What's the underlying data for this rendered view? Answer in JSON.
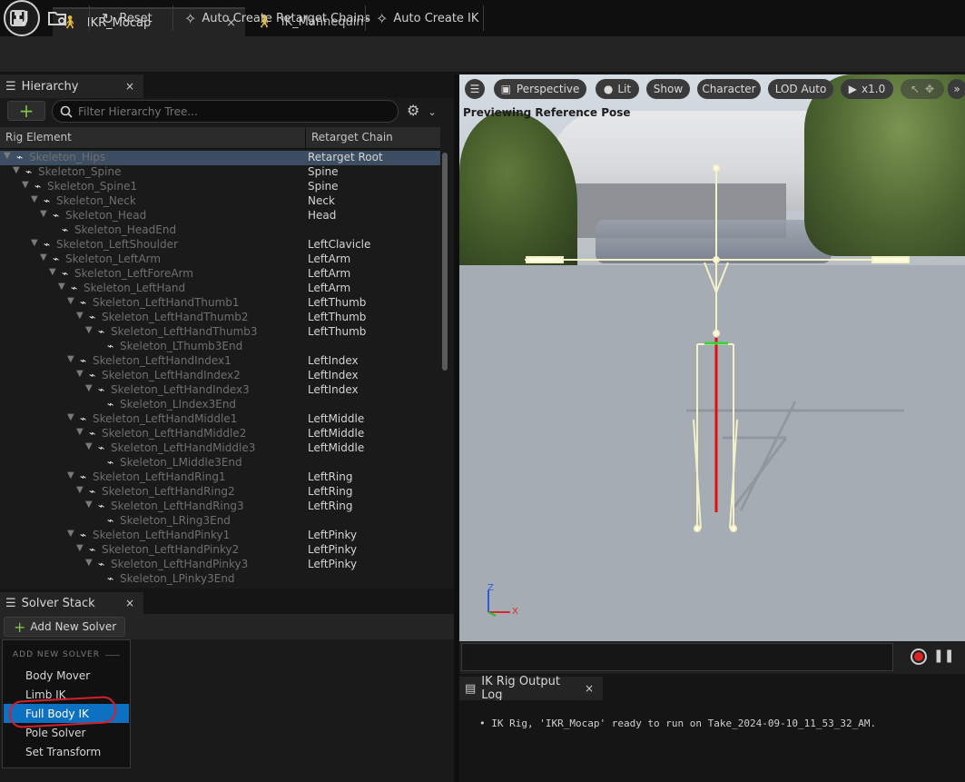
{
  "tabs": [
    {
      "label": "IKR_Mocap",
      "close": "×"
    },
    {
      "label": "IK_Mannequin*",
      "close": "×"
    }
  ],
  "toolbar": {
    "reset": "Reset",
    "auto_chains": "Auto Create Retarget Chains",
    "auto_ik": "Auto Create IK"
  },
  "hierarchy": {
    "title": "Hierarchy",
    "close": "×",
    "search_placeholder": "Filter Hierarchy Tree...",
    "col_rig": "Rig Element",
    "col_chain": "Retarget Chain",
    "rows": [
      {
        "name": "Skeleton_Hips",
        "chain": "Retarget Root",
        "depth": 0,
        "selected": true
      },
      {
        "name": "Skeleton_Spine",
        "chain": "Spine",
        "depth": 1
      },
      {
        "name": "Skeleton_Spine1",
        "chain": "Spine",
        "depth": 2
      },
      {
        "name": "Skeleton_Neck",
        "chain": "Neck",
        "depth": 3
      },
      {
        "name": "Skeleton_Head",
        "chain": "Head",
        "depth": 4
      },
      {
        "name": "Skeleton_HeadEnd",
        "chain": "",
        "depth": 5
      },
      {
        "name": "Skeleton_LeftShoulder",
        "chain": "LeftClavicle",
        "depth": 3
      },
      {
        "name": "Skeleton_LeftArm",
        "chain": "LeftArm",
        "depth": 4
      },
      {
        "name": "Skeleton_LeftForeArm",
        "chain": "LeftArm",
        "depth": 5
      },
      {
        "name": "Skeleton_LeftHand",
        "chain": "LeftArm",
        "depth": 6
      },
      {
        "name": "Skeleton_LeftHandThumb1",
        "chain": "LeftThumb",
        "depth": 7
      },
      {
        "name": "Skeleton_LeftHandThumb2",
        "chain": "LeftThumb",
        "depth": 8
      },
      {
        "name": "Skeleton_LeftHandThumb3",
        "chain": "LeftThumb",
        "depth": 9
      },
      {
        "name": "Skeleton_LThumb3End",
        "chain": "",
        "depth": 10
      },
      {
        "name": "Skeleton_LeftHandIndex1",
        "chain": "LeftIndex",
        "depth": 7
      },
      {
        "name": "Skeleton_LeftHandIndex2",
        "chain": "LeftIndex",
        "depth": 8
      },
      {
        "name": "Skeleton_LeftHandIndex3",
        "chain": "LeftIndex",
        "depth": 9
      },
      {
        "name": "Skeleton_LIndex3End",
        "chain": "",
        "depth": 10
      },
      {
        "name": "Skeleton_LeftHandMiddle1",
        "chain": "LeftMiddle",
        "depth": 7
      },
      {
        "name": "Skeleton_LeftHandMiddle2",
        "chain": "LeftMiddle",
        "depth": 8
      },
      {
        "name": "Skeleton_LeftHandMiddle3",
        "chain": "LeftMiddle",
        "depth": 9
      },
      {
        "name": "Skeleton_LMiddle3End",
        "chain": "",
        "depth": 10
      },
      {
        "name": "Skeleton_LeftHandRing1",
        "chain": "LeftRing",
        "depth": 7
      },
      {
        "name": "Skeleton_LeftHandRing2",
        "chain": "LeftRing",
        "depth": 8
      },
      {
        "name": "Skeleton_LeftHandRing3",
        "chain": "LeftRing",
        "depth": 9
      },
      {
        "name": "Skeleton_LRing3End",
        "chain": "",
        "depth": 10
      },
      {
        "name": "Skeleton_LeftHandPinky1",
        "chain": "LeftPinky",
        "depth": 7
      },
      {
        "name": "Skeleton_LeftHandPinky2",
        "chain": "LeftPinky",
        "depth": 8
      },
      {
        "name": "Skeleton_LeftHandPinky3",
        "chain": "LeftPinky",
        "depth": 9
      },
      {
        "name": "Skeleton_LPinky3End",
        "chain": "",
        "depth": 10
      }
    ]
  },
  "solver": {
    "title": "Solver Stack",
    "close": "×",
    "add_label": "Add New Solver",
    "menu_header": "ADD NEW SOLVER",
    "items": [
      "Body Mover",
      "Limb IK",
      "Full Body IK",
      "Pole Solver",
      "Set Transform"
    ],
    "highlighted": "Full Body IK"
  },
  "viewport": {
    "perspective": "Perspective",
    "lit": "Lit",
    "show": "Show",
    "character": "Character",
    "lod": "LOD Auto",
    "speed": "x1.0",
    "preview_text": "Previewing Reference Pose",
    "axis_z": "Z",
    "axis_x": "X"
  },
  "log": {
    "title": "IK Rig Output Log",
    "close": "×",
    "line": "IK Rig, 'IKR_Mocap' ready to run on Take_2024-09-10_11_53_32_AM."
  },
  "colors": {
    "accent_blue": "#0e70c0",
    "selection": "#3d4d62",
    "add_green": "#7fc14a",
    "annotation_red": "#d4202a"
  }
}
